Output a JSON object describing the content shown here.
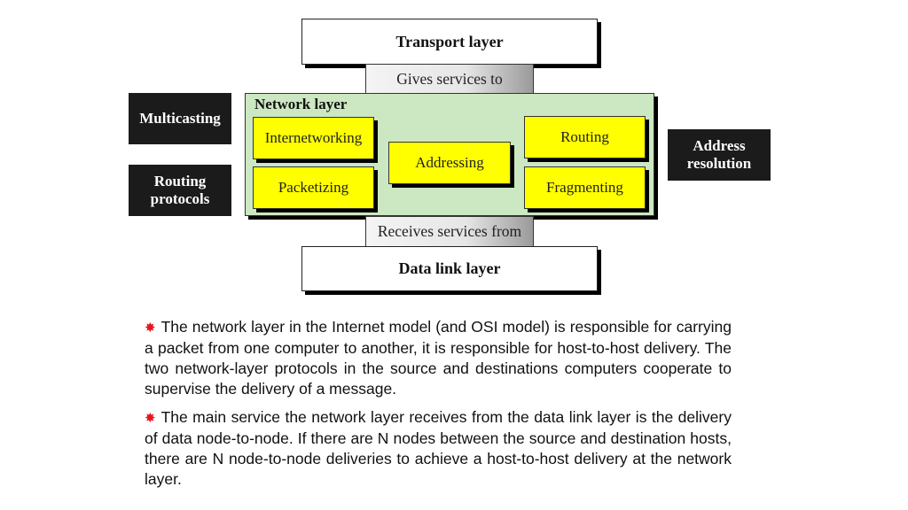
{
  "diagram": {
    "top_layer": "Transport layer",
    "gives_label": "Gives services to",
    "network_layer": {
      "title": "Network layer",
      "functions": [
        "Internetworking",
        "Packetizing",
        "Addressing",
        "Routing",
        "Fragmenting"
      ]
    },
    "receives_label": "Receives services from",
    "bottom_layer": "Data link layer",
    "left_protocols": [
      "Multicasting",
      "Routing protocols"
    ],
    "right_protocols": [
      "Address resolution"
    ],
    "colors": {
      "network_fill": "#cce8c2",
      "function_fill": "#ffff00",
      "protocol_fill": "#1b1b1b",
      "bullet": "#e8141e"
    }
  },
  "text": {
    "bullet_icon": "✸",
    "paragraphs": [
      "The network layer in the Internet model (and OSI model) is responsible for carrying a packet from one computer to another, it is responsible for host-to-host delivery. The two network-layer protocols in the source and destinations computers cooperate to supervise the delivery of a message.",
      "The main service the network layer receives from the data link layer is the delivery of data node-to-node. If there are N nodes between the source and destination hosts, there are N node-to-node deliveries to achieve a host-to-host delivery at the network layer."
    ]
  }
}
